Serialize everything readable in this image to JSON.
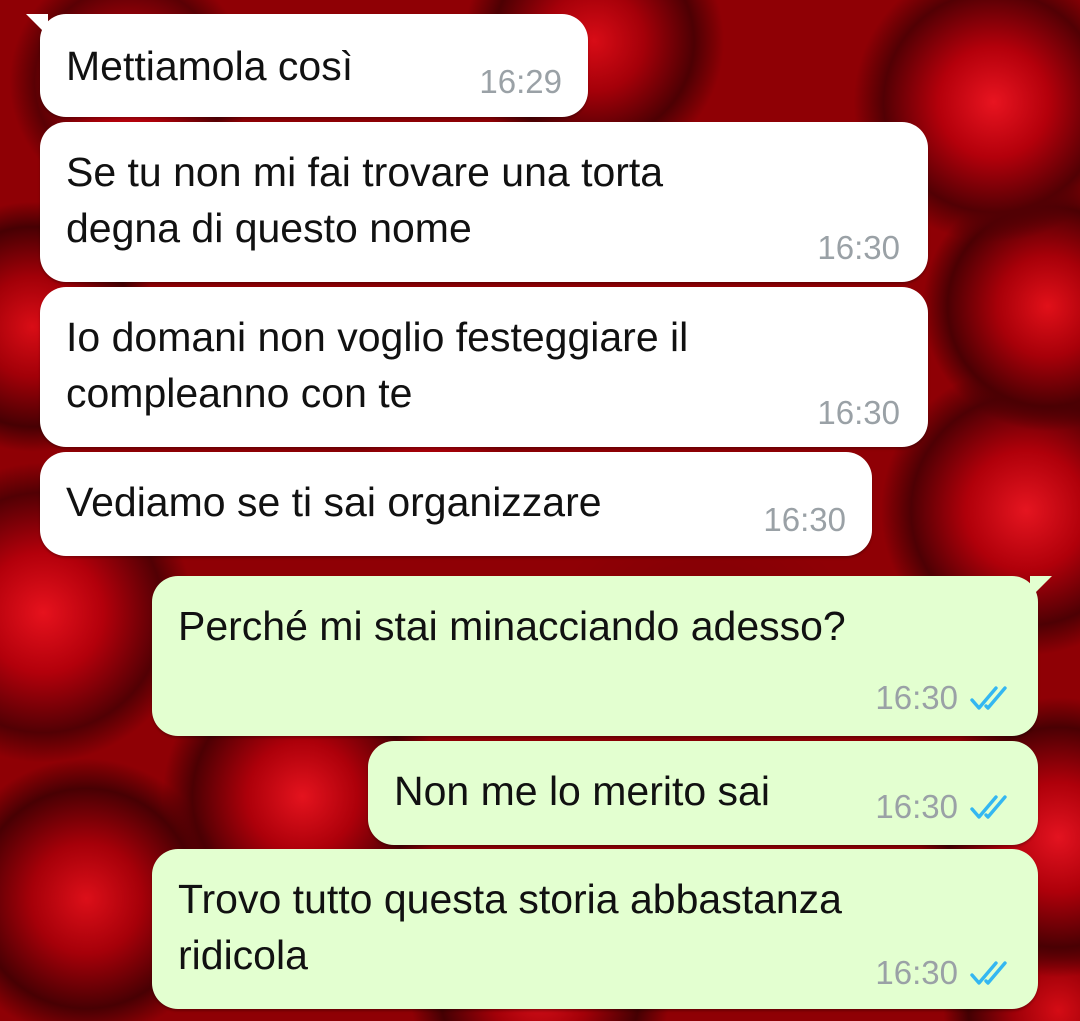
{
  "chat": {
    "messages": [
      {
        "direction": "in",
        "lines": [
          "Mettiamola così"
        ],
        "time": "16:29"
      },
      {
        "direction": "in",
        "lines": [
          "Se tu non mi fai trovare una torta",
          "degna di questo nome"
        ],
        "time": "16:30"
      },
      {
        "direction": "in",
        "lines": [
          "Io domani non voglio festeggiare il",
          "compleanno con te"
        ],
        "time": "16:30"
      },
      {
        "direction": "in",
        "lines": [
          "Vediamo se ti sai organizzare"
        ],
        "time": "16:30"
      },
      {
        "direction": "out",
        "lines": [
          "Perché mi stai minacciando adesso?"
        ],
        "time": "16:30",
        "status": "read-double-check-icon"
      },
      {
        "direction": "out",
        "lines": [
          "Non me lo merito sai"
        ],
        "time": "16:30",
        "status": "read-double-check-icon"
      },
      {
        "direction": "out",
        "lines": [
          "Trovo tutto questa storia abbastanza",
          "ridicola"
        ],
        "time": "16:30",
        "status": "read-double-check-icon"
      }
    ]
  },
  "colors": {
    "incoming_bubble": "#ffffff",
    "outgoing_bubble": "#e3ffd0",
    "read_tick": "#34b7f1",
    "wallpaper": "#a00008"
  }
}
